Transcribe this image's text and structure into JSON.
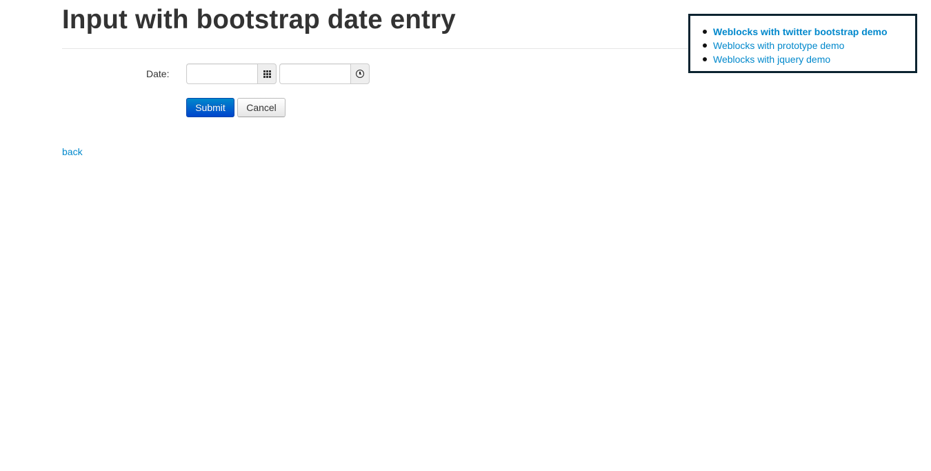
{
  "page": {
    "title": "Input with bootstrap date entry"
  },
  "demo_links": {
    "items": [
      {
        "label": "Weblocks with twitter bootstrap demo",
        "active": true
      },
      {
        "label": "Weblocks with prototype demo",
        "active": false
      },
      {
        "label": "Weblocks with jquery demo",
        "active": false
      }
    ]
  },
  "form": {
    "date_label": "Date:",
    "date_value": "",
    "date_placeholder": "",
    "time_value": "",
    "time_placeholder": "",
    "date_addon_icon": "calendar-grid-icon",
    "time_addon_icon": "clock-icon",
    "submit_label": "Submit",
    "cancel_label": "Cancel"
  },
  "footer": {
    "back_label": "back"
  },
  "colors": {
    "link": "#0088cc",
    "primary_button": "#0055cc",
    "demo_box_border": "#0b2330"
  }
}
